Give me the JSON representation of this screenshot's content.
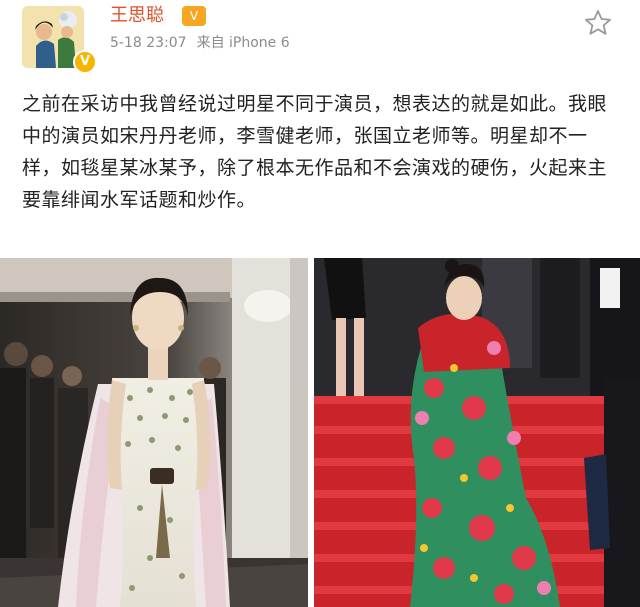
{
  "post": {
    "username": "王思聪",
    "level_badge": "V",
    "verified_badge": "V",
    "timestamp": "5-18 23:07",
    "source": "来自 iPhone 6",
    "text": "之前在采访中我曾经说过明星不同于演员，想表达的就是如此。我眼中的演员如宋丹丹老师，李雪健老师，张国立老师等。明星却不一样，如毯星某冰某予，除了根本无作品和不会演戏的硬伤，火起来主要靠绯闻水军话题和炒作。"
  },
  "icons": {
    "favorite": "star-icon",
    "verified": "verified-badge-icon"
  },
  "colors": {
    "username": "#e0522a",
    "meta": "#8a8a8a",
    "level_badge": "#f6a623",
    "verified_badge": "#f7b500"
  }
}
